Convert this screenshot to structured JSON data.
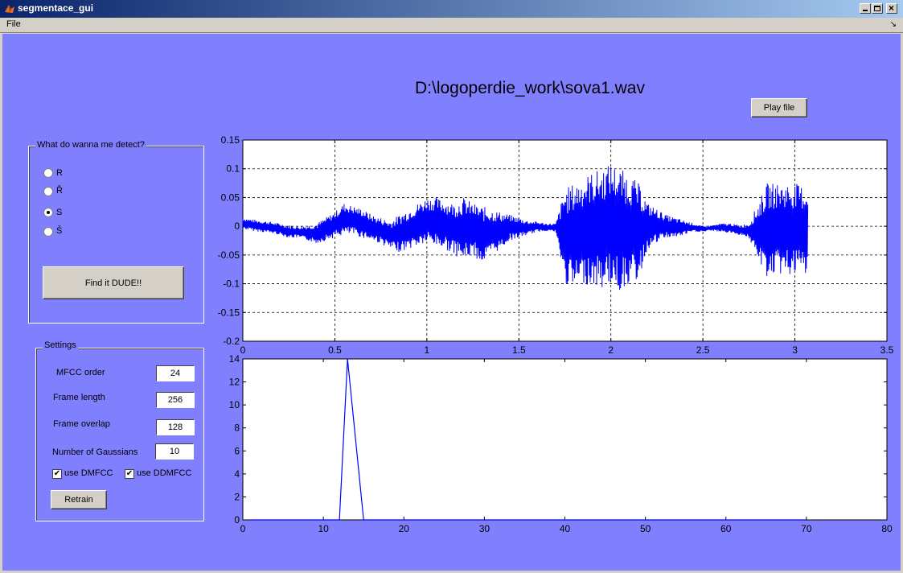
{
  "window": {
    "title": "segmentace_gui"
  },
  "menu": {
    "file": "File",
    "dock": "↘"
  },
  "file_title": "D:\\logoperdie_work\\sova1.wav",
  "play_button": "Play file",
  "detect_panel": {
    "title": "What do wanna me detect?",
    "options": [
      "R",
      "Ř",
      "S",
      "Š"
    ],
    "selected": "S",
    "find_button": "Find it DUDE!!"
  },
  "settings": {
    "title": "Settings",
    "mfcc_label": "MFCC order",
    "mfcc_value": "24",
    "frame_length_label": "Frame length",
    "frame_length_value": "256",
    "frame_overlap_label": "Frame overlap",
    "frame_overlap_value": "128",
    "gaussians_label": "Number of Gaussians",
    "gaussians_value": "10",
    "dmfcc_label": "use DMFCC",
    "dmfcc_checked": true,
    "ddmfcc_label": "use DDMFCC",
    "ddmfcc_checked": true,
    "retrain_button": "Retrain"
  },
  "colors": {
    "figure_bg": "#8080ff",
    "line": "#0000ff"
  },
  "chart_data": [
    {
      "type": "line",
      "xlim": [
        0,
        3.5
      ],
      "ylim": [
        -0.2,
        0.15
      ],
      "xticks": [
        "0",
        "0.5",
        "1",
        "1.5",
        "2",
        "2.5",
        "3",
        "3.5"
      ],
      "yticks": [
        "0.15",
        "0.1",
        "0.05",
        "0",
        "-0.05",
        "-0.1",
        "-0.15",
        "-0.2"
      ],
      "grid": true,
      "series": [
        {
          "x": [
            0,
            0.05,
            0.1,
            0.15,
            0.2,
            0.25,
            0.3,
            0.35,
            0.4,
            0.45,
            0.5,
            0.55,
            0.6,
            0.65,
            0.7,
            0.75,
            0.8,
            0.85,
            0.9,
            0.95,
            1.0,
            1.05,
            1.1,
            1.15,
            1.2,
            1.25,
            1.3,
            1.35,
            1.4,
            1.45,
            1.5,
            1.55,
            1.6,
            1.65,
            1.7,
            1.75,
            1.8,
            1.85,
            1.9,
            1.95,
            2.0,
            2.05,
            2.1,
            2.15,
            2.2,
            2.25,
            2.3,
            2.35,
            2.4,
            2.45,
            2.5,
            2.55,
            2.6,
            2.65,
            2.7,
            2.75,
            2.8,
            2.85,
            2.9,
            2.95,
            3.0,
            3.05,
            3.07
          ],
          "env_max": [
            0.015,
            0.012,
            0.01,
            0.008,
            0.005,
            0.002,
            0.0,
            0.002,
            0.005,
            0.015,
            0.025,
            0.04,
            0.035,
            0.03,
            0.02,
            0.015,
            0.01,
            0.02,
            0.03,
            0.04,
            0.05,
            0.05,
            0.045,
            0.04,
            0.05,
            0.04,
            0.035,
            0.03,
            0.025,
            0.02,
            0.015,
            0.01,
            0.008,
            0.005,
            0.005,
            0.065,
            0.075,
            0.085,
            0.095,
            0.1,
            0.11,
            0.1,
            0.09,
            0.075,
            0.04,
            0.03,
            0.02,
            0.015,
            0.01,
            0.005,
            0.0,
            0.002,
            0.005,
            0.005,
            0.002,
            0.005,
            0.04,
            0.075,
            0.075,
            0.075,
            0.075,
            0.07,
            0.065
          ],
          "env_min": [
            -0.005,
            -0.008,
            -0.01,
            -0.012,
            -0.015,
            -0.02,
            -0.02,
            -0.025,
            -0.03,
            -0.025,
            -0.02,
            -0.015,
            -0.015,
            -0.02,
            -0.025,
            -0.03,
            -0.04,
            -0.045,
            -0.04,
            -0.035,
            -0.03,
            -0.035,
            -0.04,
            -0.05,
            -0.06,
            -0.05,
            -0.065,
            -0.05,
            -0.04,
            -0.025,
            -0.02,
            -0.015,
            -0.01,
            -0.008,
            -0.01,
            -0.1,
            -0.11,
            -0.1,
            -0.105,
            -0.11,
            -0.1,
            -0.115,
            -0.1,
            -0.095,
            -0.04,
            -0.03,
            -0.02,
            -0.02,
            -0.015,
            -0.01,
            -0.01,
            -0.008,
            -0.01,
            -0.012,
            -0.015,
            -0.02,
            -0.06,
            -0.09,
            -0.085,
            -0.085,
            -0.085,
            -0.085,
            -0.085
          ]
        }
      ]
    },
    {
      "type": "line",
      "xlim": [
        0,
        80
      ],
      "ylim": [
        0,
        14
      ],
      "xticks": [
        "0",
        "10",
        "20",
        "30",
        "40",
        "50",
        "60",
        "70",
        "80"
      ],
      "yticks": [
        "14",
        "12",
        "10",
        "8",
        "6",
        "4",
        "2",
        "0"
      ],
      "grid": false,
      "series": [
        {
          "x": [
            1,
            12,
            13,
            15,
            16,
            70
          ],
          "y": [
            0,
            0,
            14,
            0,
            0,
            0
          ]
        }
      ]
    }
  ]
}
